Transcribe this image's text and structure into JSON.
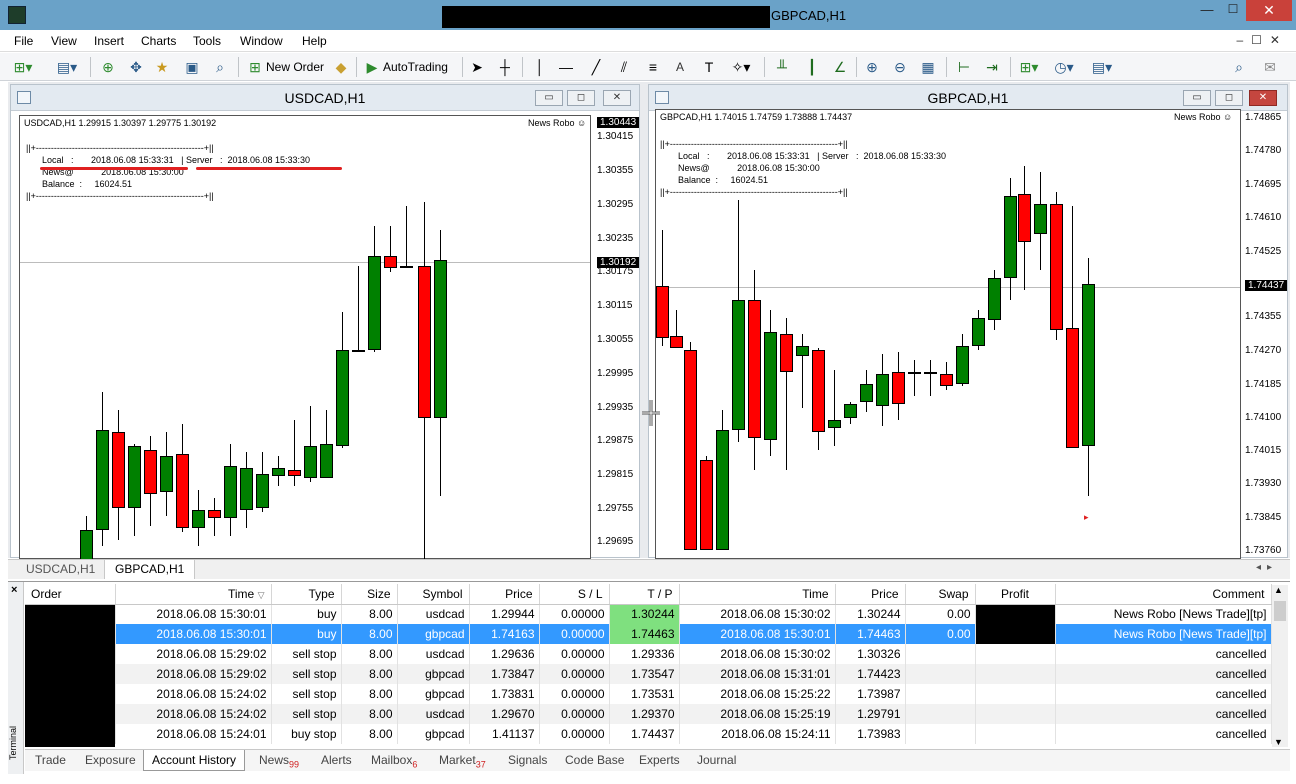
{
  "window": {
    "title": "GBPCAD,H1",
    "min_label": "—",
    "max_label": "☐",
    "close_label": "✕"
  },
  "menu": [
    "File",
    "View",
    "Insert",
    "Charts",
    "Tools",
    "Window",
    "Help"
  ],
  "toolbar": {
    "new_order": "New Order",
    "autotrading": "AutoTrading",
    "text_tool": "A"
  },
  "charts": {
    "usd": {
      "title": "USDCAD,H1",
      "symbol_line": "USDCAD,H1  1.29915 1.30397 1.29775 1.30192",
      "robo": "News Robo ☺",
      "info_border": "||+--------------------------------------------------------+||",
      "info_local": "Local   :       2018.06.08 15:33:31   | Server   :  2018.06.08 15:33:30",
      "info_news": "News@           2018.06.08 15:30:00",
      "info_balance": "Balance  :     16024.51",
      "current_price": "1.30192",
      "top_price": "1.30443",
      "prices": [
        "1.30415",
        "1.30355",
        "1.30295",
        "1.30235",
        "1.30175",
        "1.30115",
        "1.30055",
        "1.29995",
        "1.29935",
        "1.29875",
        "1.29815",
        "1.29755",
        "1.29695"
      ]
    },
    "gbp": {
      "title": "GBPCAD,H1",
      "symbol_line": "GBPCAD,H1  1.74015 1.74759 1.73888 1.74437",
      "robo": "News Robo ☺",
      "info_border": "||+--------------------------------------------------------+||",
      "info_local": "Local   :       2018.06.08 15:33:31   | Server   :  2018.06.08 15:33:30",
      "info_news": "News@           2018.06.08 15:30:00",
      "info_balance": "Balance  :     16024.51",
      "current_price": "1.74437",
      "prices": [
        "1.74865",
        "1.74780",
        "1.74695",
        "1.74610",
        "1.74525",
        "1.74440",
        "1.74355",
        "1.74270",
        "1.74185",
        "1.74100",
        "1.74015",
        "1.73930",
        "1.73845",
        "1.73760"
      ]
    }
  },
  "chart_tabs": [
    "USDCAD,H1",
    "GBPCAD,H1"
  ],
  "history": {
    "columns": [
      "Order",
      "Time",
      "Type",
      "Size",
      "Symbol",
      "Price",
      "S / L",
      "T / P",
      "Time",
      "Price",
      "Swap",
      "Profit",
      "Comment"
    ],
    "rows": [
      [
        "",
        "2018.06.08 15:30:01",
        "buy",
        "8.00",
        "usdcad",
        "1.29944",
        "0.00000",
        "1.30244",
        "2018.06.08 15:30:02",
        "1.30244",
        "0.00",
        "",
        "News Robo [News Trade][tp]"
      ],
      [
        "",
        "2018.06.08 15:30:01",
        "buy",
        "8.00",
        "gbpcad",
        "1.74163",
        "0.00000",
        "1.74463",
        "2018.06.08 15:30:01",
        "1.74463",
        "0.00",
        "",
        "News Robo [News Trade][tp]"
      ],
      [
        "",
        "2018.06.08 15:29:02",
        "sell stop",
        "8.00",
        "usdcad",
        "1.29636",
        "0.00000",
        "1.29336",
        "2018.06.08 15:30:02",
        "1.30326",
        "",
        "",
        "cancelled"
      ],
      [
        "",
        "2018.06.08 15:29:02",
        "sell stop",
        "8.00",
        "gbpcad",
        "1.73847",
        "0.00000",
        "1.73547",
        "2018.06.08 15:31:01",
        "1.74423",
        "",
        "",
        "cancelled"
      ],
      [
        "",
        "2018.06.08 15:24:02",
        "sell stop",
        "8.00",
        "gbpcad",
        "1.73831",
        "0.00000",
        "1.73531",
        "2018.06.08 15:25:22",
        "1.73987",
        "",
        "",
        "cancelled"
      ],
      [
        "",
        "2018.06.08 15:24:02",
        "sell stop",
        "8.00",
        "usdcad",
        "1.29670",
        "0.00000",
        "1.29370",
        "2018.06.08 15:25:19",
        "1.29791",
        "",
        "",
        "cancelled"
      ],
      [
        "",
        "2018.06.08 15:24:01",
        "buy stop",
        "8.00",
        "gbpcad",
        "1.41137",
        "0.00000",
        "1.74437",
        "2018.06.08 15:24:11",
        "1.73983",
        "",
        "",
        "cancelled"
      ]
    ]
  },
  "terminal_label": "Terminal",
  "bottom_tabs": [
    {
      "label": "Trade"
    },
    {
      "label": "Exposure"
    },
    {
      "label": "Account History"
    },
    {
      "label": "News",
      "badge": "99"
    },
    {
      "label": "Alerts"
    },
    {
      "label": "Mailbox",
      "badge": "6"
    },
    {
      "label": "Market",
      "badge": "37"
    },
    {
      "label": "Signals"
    },
    {
      "label": "Code Base"
    },
    {
      "label": "Experts"
    },
    {
      "label": "Journal"
    }
  ],
  "colors": {
    "bull": "#008000",
    "bear": "#ff0000",
    "selected_row": "#3399ff",
    "tp_highlight": "#7fe07f",
    "titlebar": "#6aa2c8"
  }
}
